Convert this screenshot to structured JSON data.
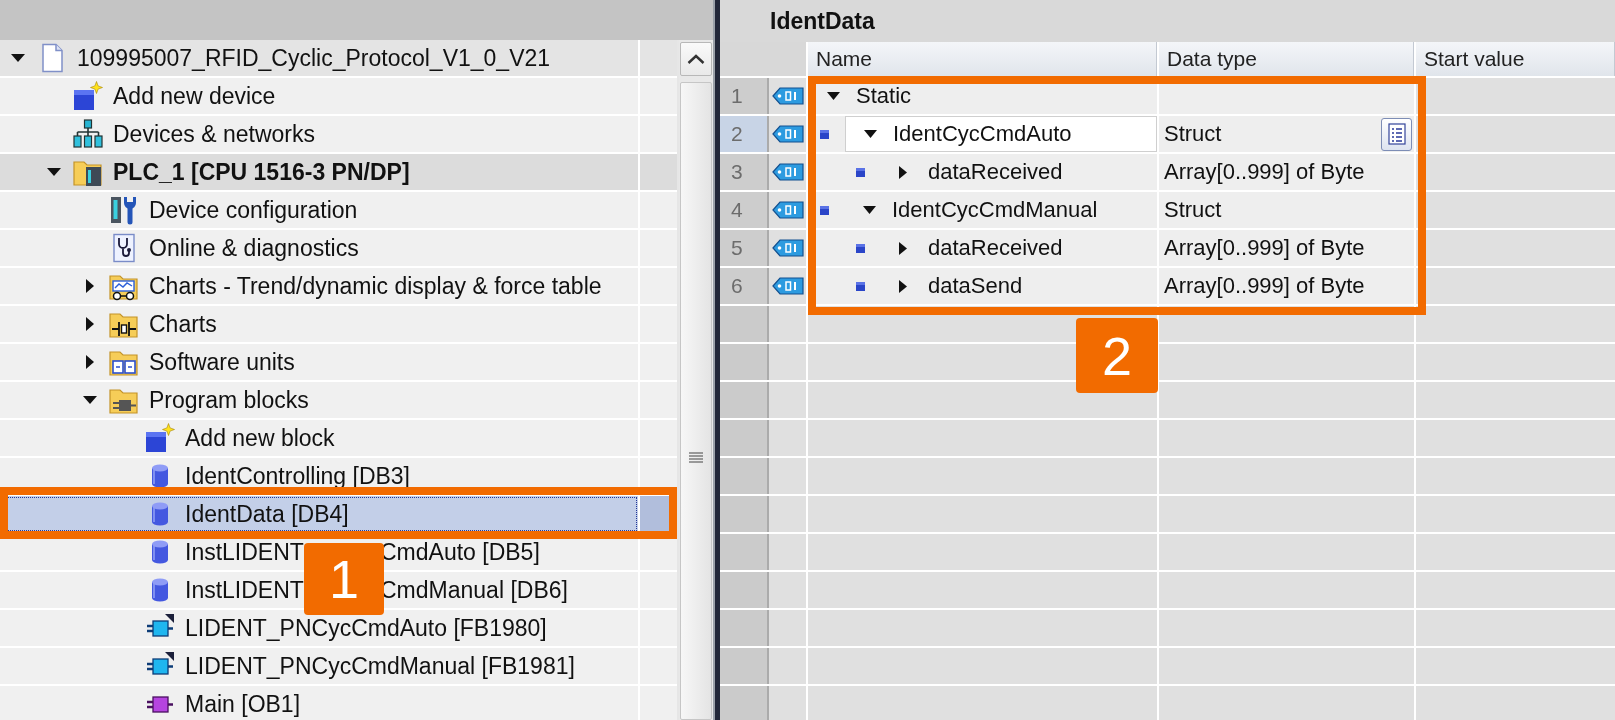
{
  "project_tree": {
    "items": [
      {
        "label": "109995007_RFID_Cyclic_Protocol_V1_0_V21",
        "kind": "project",
        "expanded": true,
        "selected": false,
        "children": [
          {
            "label": "Add new device",
            "kind": "add",
            "selected": false
          },
          {
            "label": "Devices & networks",
            "kind": "network",
            "selected": false
          },
          {
            "label": "PLC_1 [CPU 1516-3 PN/DP]",
            "kind": "device",
            "expanded": true,
            "selected": false,
            "children": [
              {
                "label": "Device configuration",
                "kind": "config",
                "selected": false
              },
              {
                "label": "Online & diagnostics",
                "kind": "diagnostics",
                "selected": false
              },
              {
                "label": "Charts - Trend/dynamic display & force table",
                "kind": "trend-folder",
                "expanded": false,
                "selected": false
              },
              {
                "label": "Charts",
                "kind": "chart-folder",
                "expanded": false,
                "selected": false
              },
              {
                "label": "Software units",
                "kind": "units-folder",
                "expanded": false,
                "selected": false
              },
              {
                "label": "Program blocks",
                "kind": "blocks-folder",
                "expanded": true,
                "selected": false,
                "children": [
                  {
                    "label": "Add new block",
                    "kind": "add",
                    "selected": false
                  },
                  {
                    "label": "IdentControlling [DB3]",
                    "kind": "data-block",
                    "selected": false
                  },
                  {
                    "label": "IdentData [DB4]",
                    "kind": "data-block",
                    "selected": true
                  },
                  {
                    "label": "InstLIDENT",
                    "label_after_callout": "CmdAuto [DB5]",
                    "kind": "data-block",
                    "selected": false
                  },
                  {
                    "label": "InstLIDENT",
                    "label_after_callout": "CmdManual [DB6]",
                    "kind": "data-block",
                    "selected": false
                  },
                  {
                    "label": "LIDENT_PNCycCmdAuto [FB1980]",
                    "kind": "function-block",
                    "selected": false
                  },
                  {
                    "label": "LIDENT_PNCycCmdManual [FB1981]",
                    "kind": "function-block",
                    "selected": false
                  },
                  {
                    "label": "Main [OB1]",
                    "kind": "org-block",
                    "selected": false
                  }
                ]
              }
            ]
          }
        ]
      }
    ],
    "callout": {
      "number": "1"
    }
  },
  "block_editor": {
    "title": "IdentData",
    "columns": [
      "Name",
      "Data type",
      "Start value"
    ],
    "rows": [
      {
        "number": "1",
        "name": "Static",
        "expanded": true,
        "selected": false,
        "children": [
          {
            "number": "2",
            "name": "IdentCycCmdAuto",
            "data_type": "Struct",
            "expanded": true,
            "selected": true,
            "children": [
              {
                "number": "3",
                "name": "dataReceived",
                "data_type": "Array[0..999] of Byte",
                "expanded": false,
                "selected": false
              }
            ]
          },
          {
            "number": "4",
            "name": "IdentCycCmdManual",
            "data_type": "Struct",
            "expanded": true,
            "selected": false,
            "children": [
              {
                "number": "5",
                "name": "dataReceived",
                "data_type": "Array[0..999] of Byte",
                "expanded": false,
                "selected": false
              },
              {
                "number": "6",
                "name": "dataSend",
                "data_type": "Array[0..999] of Byte",
                "expanded": false,
                "selected": false
              }
            ]
          }
        ]
      }
    ],
    "callout": {
      "number": "2"
    }
  }
}
